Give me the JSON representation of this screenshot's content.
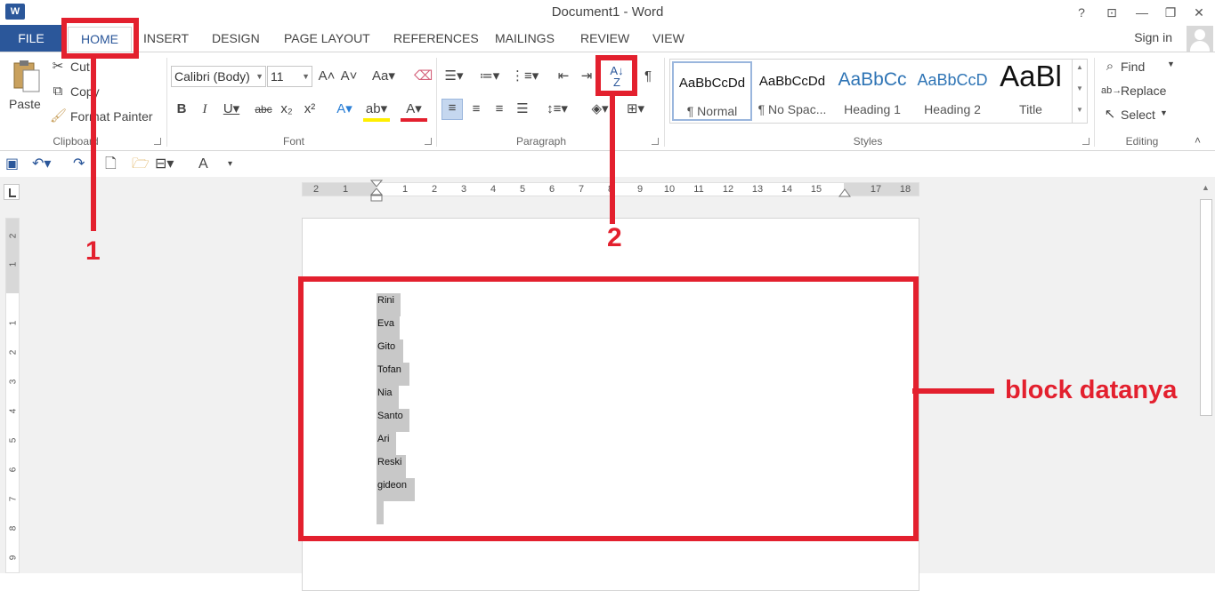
{
  "app": {
    "icon_letter": "W",
    "title": "Document1 - Word",
    "sign_in": "Sign in"
  },
  "window_buttons": {
    "help": "?",
    "restore_ribbon": "⊡",
    "minimize": "—",
    "maximize": "❐",
    "close": "✕"
  },
  "tabs": [
    {
      "label": "FILE"
    },
    {
      "label": "HOME"
    },
    {
      "label": "INSERT"
    },
    {
      "label": "DESIGN"
    },
    {
      "label": "PAGE LAYOUT"
    },
    {
      "label": "REFERENCES"
    },
    {
      "label": "MAILINGS"
    },
    {
      "label": "REVIEW"
    },
    {
      "label": "VIEW"
    }
  ],
  "clipboard": {
    "paste": "Paste",
    "cut": "Cut",
    "copy": "Copy",
    "format_painter": "Format Painter",
    "label": "Clipboard"
  },
  "font": {
    "font_name": "Calibri (Body)",
    "font_size": "11",
    "label": "Font"
  },
  "paragraph": {
    "label": "Paragraph"
  },
  "styles": {
    "label": "Styles",
    "items": [
      {
        "sample": "AaBbCcDd",
        "name": "¶ Normal"
      },
      {
        "sample": "AaBbCcDd",
        "name": "¶ No Spac..."
      },
      {
        "sample": "AaBbCc",
        "name": "Heading 1"
      },
      {
        "sample": "AaBbCcD",
        "name": "Heading 2"
      },
      {
        "sample": "AaBl",
        "name": "Title"
      }
    ]
  },
  "editing": {
    "find": "Find",
    "replace": "Replace",
    "select": "Select",
    "label": "Editing"
  },
  "ruler": {
    "horizontal_ticks": [
      "2",
      "1",
      "1",
      "2",
      "3",
      "4",
      "5",
      "6",
      "7",
      "8",
      "9",
      "10",
      "11",
      "12",
      "13",
      "14",
      "15",
      "",
      "17",
      "18"
    ],
    "vertical_ticks": [
      "2",
      "1",
      "1",
      "1",
      "2",
      "3",
      "4",
      "5",
      "6",
      "7",
      "8",
      "9"
    ]
  },
  "document": {
    "names": [
      "Rini",
      "Eva",
      "Gito",
      "Tofan",
      "Nia",
      "Santo",
      "Ari",
      "Reski",
      "gideon"
    ]
  },
  "annotations": {
    "step1": "1",
    "step2": "2",
    "block_label": "block datanya"
  },
  "colors": {
    "brand": "#2b579a",
    "annotation": "#e3202e",
    "selection": "#c8c8c8"
  }
}
